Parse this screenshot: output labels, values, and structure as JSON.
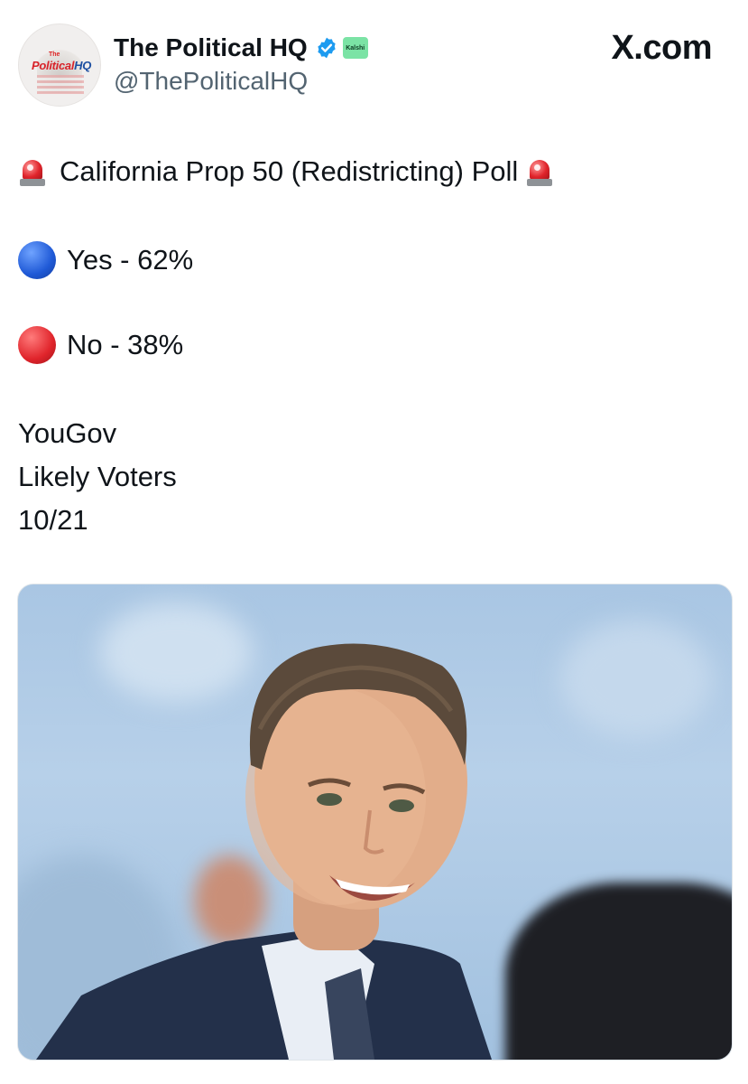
{
  "account": {
    "display_name": "The Political HQ",
    "handle": "@ThePoliticalHQ",
    "avatar_text_the": "The",
    "avatar_text_political": "Political",
    "avatar_text_hq": "HQ",
    "verified": true,
    "affiliate_badge": "Kalshi"
  },
  "source_watermark": "X.com",
  "post": {
    "title": "California Prop 50 (Redistricting) Poll",
    "yes_line": "Yes - 62%",
    "no_line": "No - 38%",
    "pollster": "YouGov",
    "population": "Likely Voters",
    "date": "10/21"
  },
  "colors": {
    "verified": "#1d9bf0",
    "text": "#0f1419",
    "secondary_text": "#536471",
    "yes_dot": "#1f59d6",
    "no_dot": "#e0242b"
  }
}
